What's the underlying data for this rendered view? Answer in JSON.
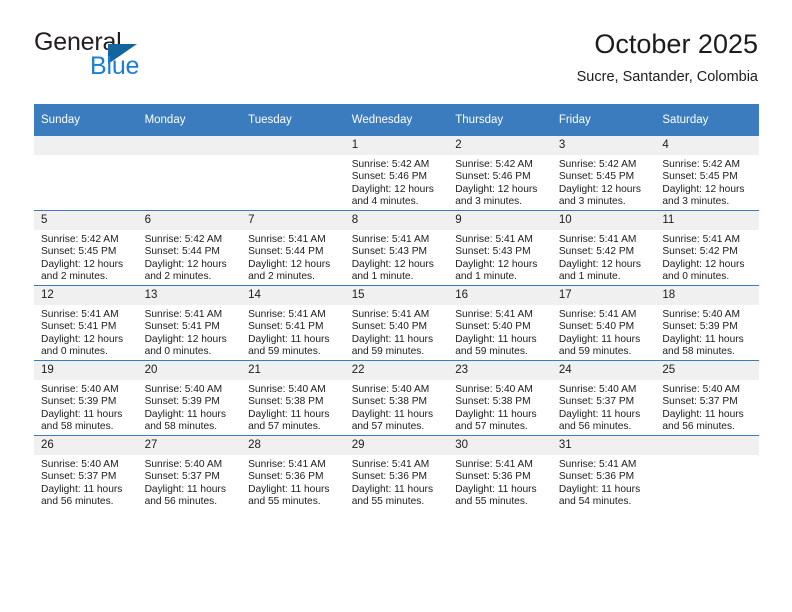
{
  "brand": {
    "name_part1": "General",
    "name_part2": "Blue",
    "accent_color": "#1a7fd4",
    "triangle_color": "#1464a0"
  },
  "header": {
    "title": "October 2025",
    "subtitle": "Sucre, Santander, Colombia"
  },
  "theme": {
    "header_bg": "#3a7cbe",
    "daynum_bg": "#f0f0f0",
    "text": "#1c1c1c"
  },
  "weekday_headers": [
    "Sunday",
    "Monday",
    "Tuesday",
    "Wednesday",
    "Thursday",
    "Friday",
    "Saturday"
  ],
  "weeks": [
    [
      {
        "day": "",
        "empty": true
      },
      {
        "day": "",
        "empty": true
      },
      {
        "day": "",
        "empty": true
      },
      {
        "day": "1",
        "sunrise": "Sunrise: 5:42 AM",
        "sunset": "Sunset: 5:46 PM",
        "daylight": "Daylight: 12 hours and 4 minutes."
      },
      {
        "day": "2",
        "sunrise": "Sunrise: 5:42 AM",
        "sunset": "Sunset: 5:46 PM",
        "daylight": "Daylight: 12 hours and 3 minutes."
      },
      {
        "day": "3",
        "sunrise": "Sunrise: 5:42 AM",
        "sunset": "Sunset: 5:45 PM",
        "daylight": "Daylight: 12 hours and 3 minutes."
      },
      {
        "day": "4",
        "sunrise": "Sunrise: 5:42 AM",
        "sunset": "Sunset: 5:45 PM",
        "daylight": "Daylight: 12 hours and 3 minutes."
      }
    ],
    [
      {
        "day": "5",
        "sunrise": "Sunrise: 5:42 AM",
        "sunset": "Sunset: 5:45 PM",
        "daylight": "Daylight: 12 hours and 2 minutes."
      },
      {
        "day": "6",
        "sunrise": "Sunrise: 5:42 AM",
        "sunset": "Sunset: 5:44 PM",
        "daylight": "Daylight: 12 hours and 2 minutes."
      },
      {
        "day": "7",
        "sunrise": "Sunrise: 5:41 AM",
        "sunset": "Sunset: 5:44 PM",
        "daylight": "Daylight: 12 hours and 2 minutes."
      },
      {
        "day": "8",
        "sunrise": "Sunrise: 5:41 AM",
        "sunset": "Sunset: 5:43 PM",
        "daylight": "Daylight: 12 hours and 1 minute."
      },
      {
        "day": "9",
        "sunrise": "Sunrise: 5:41 AM",
        "sunset": "Sunset: 5:43 PM",
        "daylight": "Daylight: 12 hours and 1 minute."
      },
      {
        "day": "10",
        "sunrise": "Sunrise: 5:41 AM",
        "sunset": "Sunset: 5:42 PM",
        "daylight": "Daylight: 12 hours and 1 minute."
      },
      {
        "day": "11",
        "sunrise": "Sunrise: 5:41 AM",
        "sunset": "Sunset: 5:42 PM",
        "daylight": "Daylight: 12 hours and 0 minutes."
      }
    ],
    [
      {
        "day": "12",
        "sunrise": "Sunrise: 5:41 AM",
        "sunset": "Sunset: 5:41 PM",
        "daylight": "Daylight: 12 hours and 0 minutes."
      },
      {
        "day": "13",
        "sunrise": "Sunrise: 5:41 AM",
        "sunset": "Sunset: 5:41 PM",
        "daylight": "Daylight: 12 hours and 0 minutes."
      },
      {
        "day": "14",
        "sunrise": "Sunrise: 5:41 AM",
        "sunset": "Sunset: 5:41 PM",
        "daylight": "Daylight: 11 hours and 59 minutes."
      },
      {
        "day": "15",
        "sunrise": "Sunrise: 5:41 AM",
        "sunset": "Sunset: 5:40 PM",
        "daylight": "Daylight: 11 hours and 59 minutes."
      },
      {
        "day": "16",
        "sunrise": "Sunrise: 5:41 AM",
        "sunset": "Sunset: 5:40 PM",
        "daylight": "Daylight: 11 hours and 59 minutes."
      },
      {
        "day": "17",
        "sunrise": "Sunrise: 5:41 AM",
        "sunset": "Sunset: 5:40 PM",
        "daylight": "Daylight: 11 hours and 59 minutes."
      },
      {
        "day": "18",
        "sunrise": "Sunrise: 5:40 AM",
        "sunset": "Sunset: 5:39 PM",
        "daylight": "Daylight: 11 hours and 58 minutes."
      }
    ],
    [
      {
        "day": "19",
        "sunrise": "Sunrise: 5:40 AM",
        "sunset": "Sunset: 5:39 PM",
        "daylight": "Daylight: 11 hours and 58 minutes."
      },
      {
        "day": "20",
        "sunrise": "Sunrise: 5:40 AM",
        "sunset": "Sunset: 5:39 PM",
        "daylight": "Daylight: 11 hours and 58 minutes."
      },
      {
        "day": "21",
        "sunrise": "Sunrise: 5:40 AM",
        "sunset": "Sunset: 5:38 PM",
        "daylight": "Daylight: 11 hours and 57 minutes."
      },
      {
        "day": "22",
        "sunrise": "Sunrise: 5:40 AM",
        "sunset": "Sunset: 5:38 PM",
        "daylight": "Daylight: 11 hours and 57 minutes."
      },
      {
        "day": "23",
        "sunrise": "Sunrise: 5:40 AM",
        "sunset": "Sunset: 5:38 PM",
        "daylight": "Daylight: 11 hours and 57 minutes."
      },
      {
        "day": "24",
        "sunrise": "Sunrise: 5:40 AM",
        "sunset": "Sunset: 5:37 PM",
        "daylight": "Daylight: 11 hours and 56 minutes."
      },
      {
        "day": "25",
        "sunrise": "Sunrise: 5:40 AM",
        "sunset": "Sunset: 5:37 PM",
        "daylight": "Daylight: 11 hours and 56 minutes."
      }
    ],
    [
      {
        "day": "26",
        "sunrise": "Sunrise: 5:40 AM",
        "sunset": "Sunset: 5:37 PM",
        "daylight": "Daylight: 11 hours and 56 minutes."
      },
      {
        "day": "27",
        "sunrise": "Sunrise: 5:40 AM",
        "sunset": "Sunset: 5:37 PM",
        "daylight": "Daylight: 11 hours and 56 minutes."
      },
      {
        "day": "28",
        "sunrise": "Sunrise: 5:41 AM",
        "sunset": "Sunset: 5:36 PM",
        "daylight": "Daylight: 11 hours and 55 minutes."
      },
      {
        "day": "29",
        "sunrise": "Sunrise: 5:41 AM",
        "sunset": "Sunset: 5:36 PM",
        "daylight": "Daylight: 11 hours and 55 minutes."
      },
      {
        "day": "30",
        "sunrise": "Sunrise: 5:41 AM",
        "sunset": "Sunset: 5:36 PM",
        "daylight": "Daylight: 11 hours and 55 minutes."
      },
      {
        "day": "31",
        "sunrise": "Sunrise: 5:41 AM",
        "sunset": "Sunset: 5:36 PM",
        "daylight": "Daylight: 11 hours and 54 minutes."
      },
      {
        "day": "",
        "empty": true
      }
    ]
  ]
}
